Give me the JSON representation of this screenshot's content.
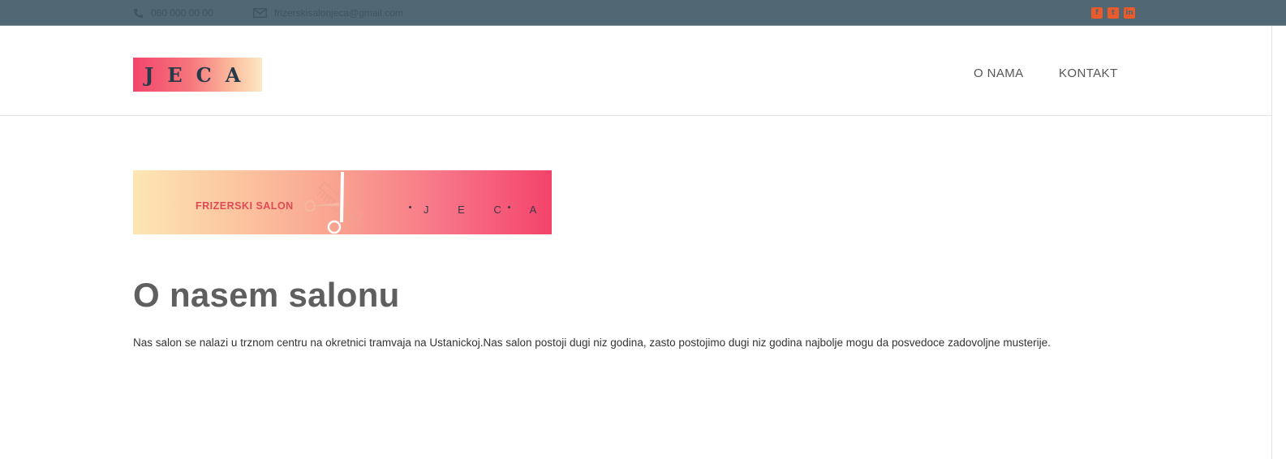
{
  "topbar": {
    "phone": "060 000 00 00",
    "email": "frizerskisalonjeca@gmail.com",
    "social": [
      "facebook-icon",
      "twitter-icon",
      "linkedin-icon"
    ],
    "bg_color": "#516773",
    "social_color": "#ea5a2a"
  },
  "header": {
    "logo_text": "JECA",
    "nav": {
      "about": "O NAMA",
      "contact": "KONTAKT"
    }
  },
  "banner": {
    "salon_text": "FRIZERSKI SALON",
    "name_text": "J E C A"
  },
  "main": {
    "title": "O nasem salonu",
    "description": "Nas salon se nalazi u trznom centru na okretnici tramvaja na Ustanickoj.Nas salon postoji dugi niz godina, zasto postojimo dugi niz godina najbolje mogu da posvedoce zadovoljne musterije."
  }
}
